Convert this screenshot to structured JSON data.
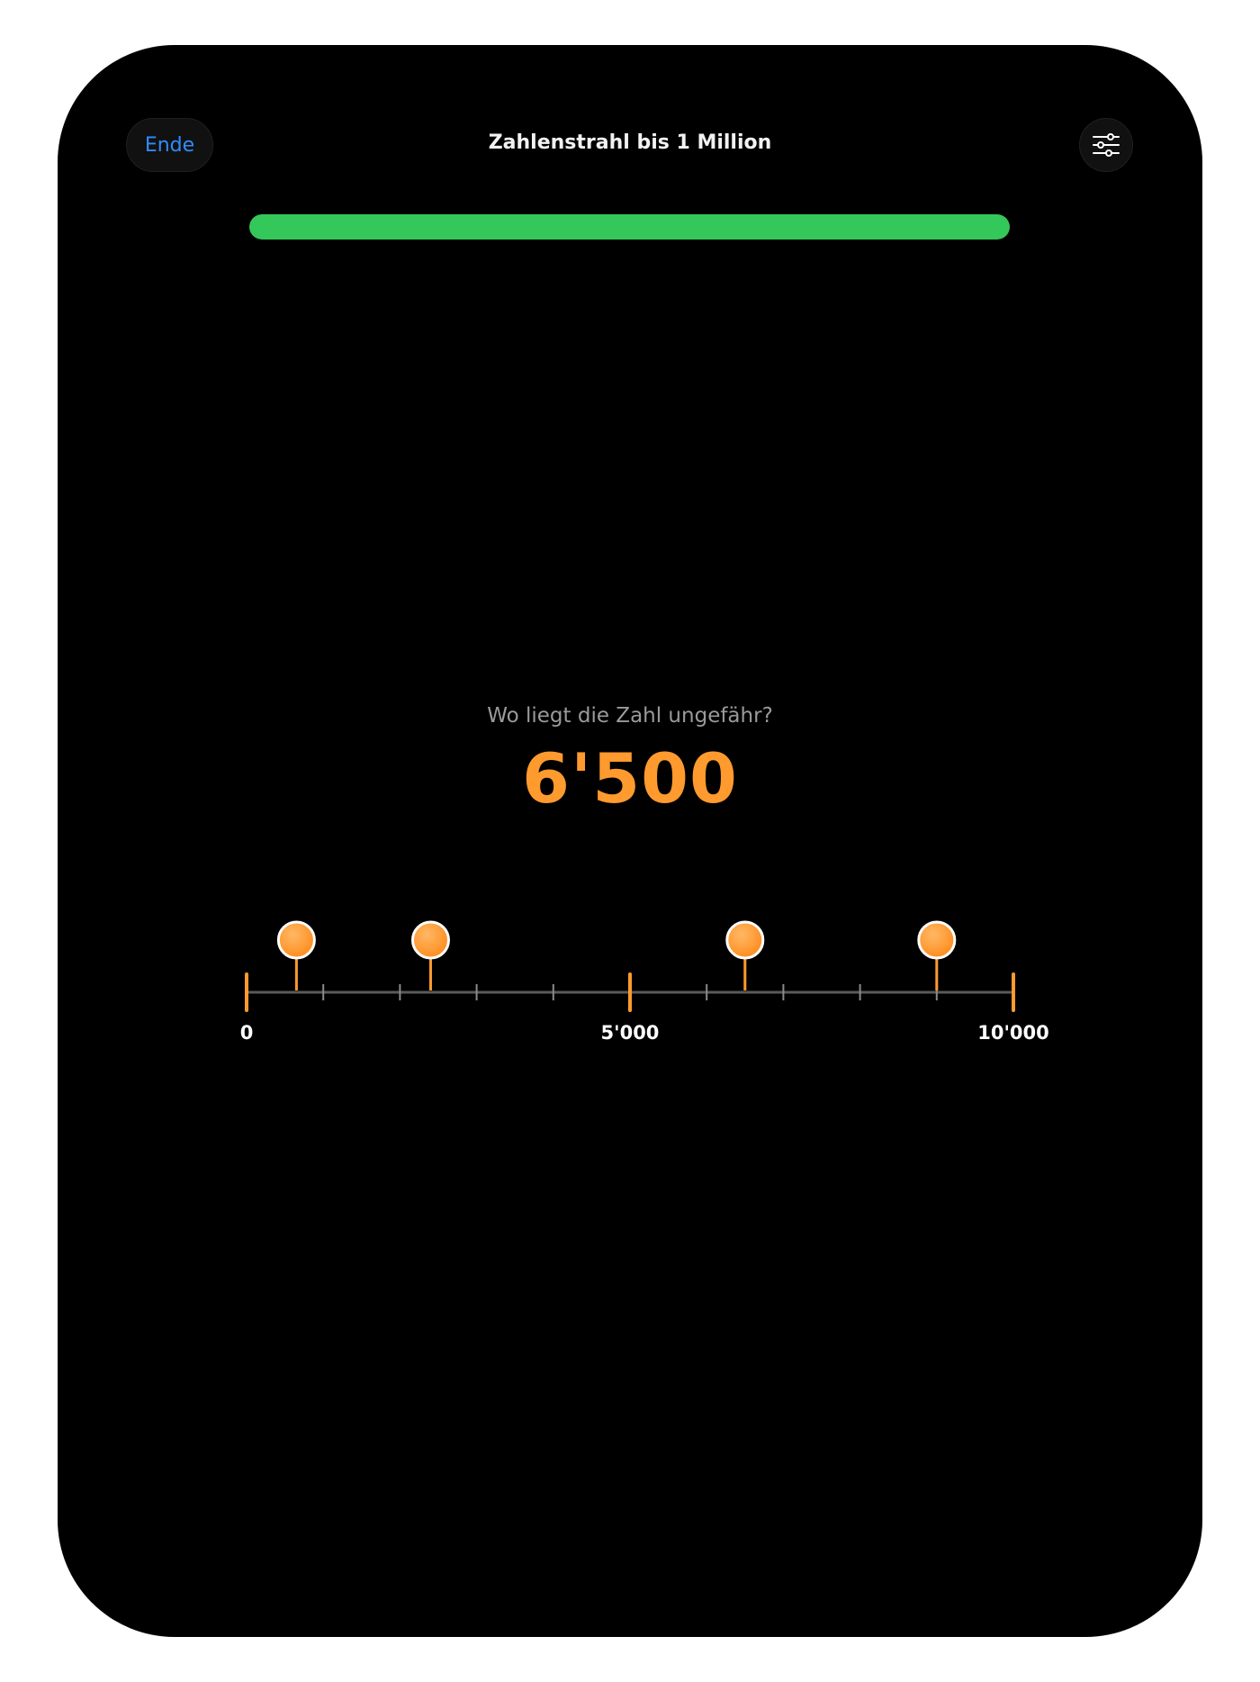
{
  "header": {
    "end_label": "Ende",
    "title": "Zahlenstrahl bis 1 Million",
    "settings_icon": "sliders-icon"
  },
  "progress": {
    "fraction": 1.0,
    "color": "#34c759"
  },
  "question": {
    "prompt": "Wo liegt die Zahl ungefähr?",
    "target": "6'500"
  },
  "numberline": {
    "min": 0,
    "max": 10000,
    "minor_step": 1000,
    "major_labels": [
      {
        "value": 0,
        "label": "0"
      },
      {
        "value": 5000,
        "label": "5'000"
      },
      {
        "value": 10000,
        "label": "10'000"
      }
    ],
    "markers": [
      650,
      2400,
      6500,
      9000
    ],
    "accent_color": "#ff9a2e"
  }
}
